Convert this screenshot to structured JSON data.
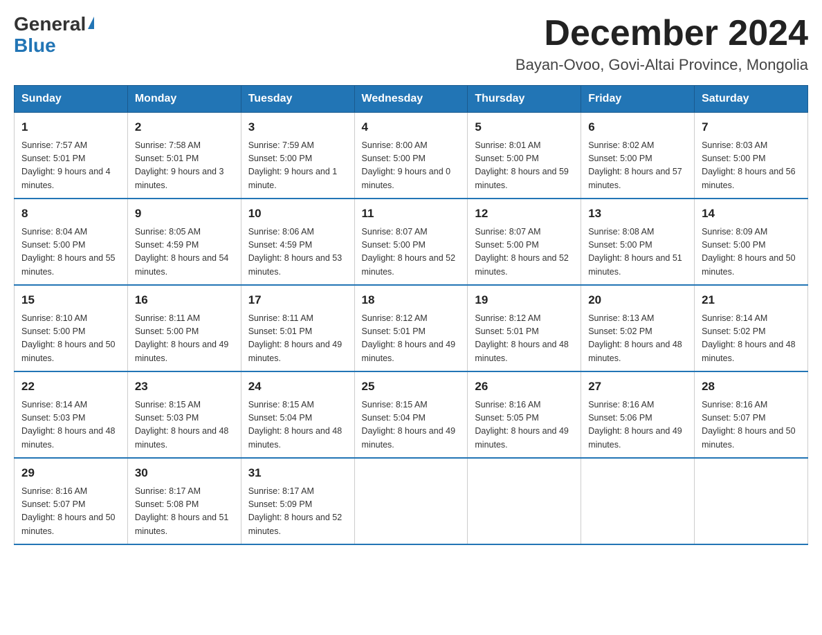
{
  "header": {
    "logo_general": "General",
    "logo_blue": "Blue",
    "month_title": "December 2024",
    "location": "Bayan-Ovoo, Govi-Altai Province, Mongolia"
  },
  "weekdays": [
    "Sunday",
    "Monday",
    "Tuesday",
    "Wednesday",
    "Thursday",
    "Friday",
    "Saturday"
  ],
  "weeks": [
    [
      {
        "day": "1",
        "sunrise": "7:57 AM",
        "sunset": "5:01 PM",
        "daylight": "9 hours and 4 minutes."
      },
      {
        "day": "2",
        "sunrise": "7:58 AM",
        "sunset": "5:01 PM",
        "daylight": "9 hours and 3 minutes."
      },
      {
        "day": "3",
        "sunrise": "7:59 AM",
        "sunset": "5:00 PM",
        "daylight": "9 hours and 1 minute."
      },
      {
        "day": "4",
        "sunrise": "8:00 AM",
        "sunset": "5:00 PM",
        "daylight": "9 hours and 0 minutes."
      },
      {
        "day": "5",
        "sunrise": "8:01 AM",
        "sunset": "5:00 PM",
        "daylight": "8 hours and 59 minutes."
      },
      {
        "day": "6",
        "sunrise": "8:02 AM",
        "sunset": "5:00 PM",
        "daylight": "8 hours and 57 minutes."
      },
      {
        "day": "7",
        "sunrise": "8:03 AM",
        "sunset": "5:00 PM",
        "daylight": "8 hours and 56 minutes."
      }
    ],
    [
      {
        "day": "8",
        "sunrise": "8:04 AM",
        "sunset": "5:00 PM",
        "daylight": "8 hours and 55 minutes."
      },
      {
        "day": "9",
        "sunrise": "8:05 AM",
        "sunset": "4:59 PM",
        "daylight": "8 hours and 54 minutes."
      },
      {
        "day": "10",
        "sunrise": "8:06 AM",
        "sunset": "4:59 PM",
        "daylight": "8 hours and 53 minutes."
      },
      {
        "day": "11",
        "sunrise": "8:07 AM",
        "sunset": "5:00 PM",
        "daylight": "8 hours and 52 minutes."
      },
      {
        "day": "12",
        "sunrise": "8:07 AM",
        "sunset": "5:00 PM",
        "daylight": "8 hours and 52 minutes."
      },
      {
        "day": "13",
        "sunrise": "8:08 AM",
        "sunset": "5:00 PM",
        "daylight": "8 hours and 51 minutes."
      },
      {
        "day": "14",
        "sunrise": "8:09 AM",
        "sunset": "5:00 PM",
        "daylight": "8 hours and 50 minutes."
      }
    ],
    [
      {
        "day": "15",
        "sunrise": "8:10 AM",
        "sunset": "5:00 PM",
        "daylight": "8 hours and 50 minutes."
      },
      {
        "day": "16",
        "sunrise": "8:11 AM",
        "sunset": "5:00 PM",
        "daylight": "8 hours and 49 minutes."
      },
      {
        "day": "17",
        "sunrise": "8:11 AM",
        "sunset": "5:01 PM",
        "daylight": "8 hours and 49 minutes."
      },
      {
        "day": "18",
        "sunrise": "8:12 AM",
        "sunset": "5:01 PM",
        "daylight": "8 hours and 49 minutes."
      },
      {
        "day": "19",
        "sunrise": "8:12 AM",
        "sunset": "5:01 PM",
        "daylight": "8 hours and 48 minutes."
      },
      {
        "day": "20",
        "sunrise": "8:13 AM",
        "sunset": "5:02 PM",
        "daylight": "8 hours and 48 minutes."
      },
      {
        "day": "21",
        "sunrise": "8:14 AM",
        "sunset": "5:02 PM",
        "daylight": "8 hours and 48 minutes."
      }
    ],
    [
      {
        "day": "22",
        "sunrise": "8:14 AM",
        "sunset": "5:03 PM",
        "daylight": "8 hours and 48 minutes."
      },
      {
        "day": "23",
        "sunrise": "8:15 AM",
        "sunset": "5:03 PM",
        "daylight": "8 hours and 48 minutes."
      },
      {
        "day": "24",
        "sunrise": "8:15 AM",
        "sunset": "5:04 PM",
        "daylight": "8 hours and 48 minutes."
      },
      {
        "day": "25",
        "sunrise": "8:15 AM",
        "sunset": "5:04 PM",
        "daylight": "8 hours and 49 minutes."
      },
      {
        "day": "26",
        "sunrise": "8:16 AM",
        "sunset": "5:05 PM",
        "daylight": "8 hours and 49 minutes."
      },
      {
        "day": "27",
        "sunrise": "8:16 AM",
        "sunset": "5:06 PM",
        "daylight": "8 hours and 49 minutes."
      },
      {
        "day": "28",
        "sunrise": "8:16 AM",
        "sunset": "5:07 PM",
        "daylight": "8 hours and 50 minutes."
      }
    ],
    [
      {
        "day": "29",
        "sunrise": "8:16 AM",
        "sunset": "5:07 PM",
        "daylight": "8 hours and 50 minutes."
      },
      {
        "day": "30",
        "sunrise": "8:17 AM",
        "sunset": "5:08 PM",
        "daylight": "8 hours and 51 minutes."
      },
      {
        "day": "31",
        "sunrise": "8:17 AM",
        "sunset": "5:09 PM",
        "daylight": "8 hours and 52 minutes."
      },
      null,
      null,
      null,
      null
    ]
  ]
}
